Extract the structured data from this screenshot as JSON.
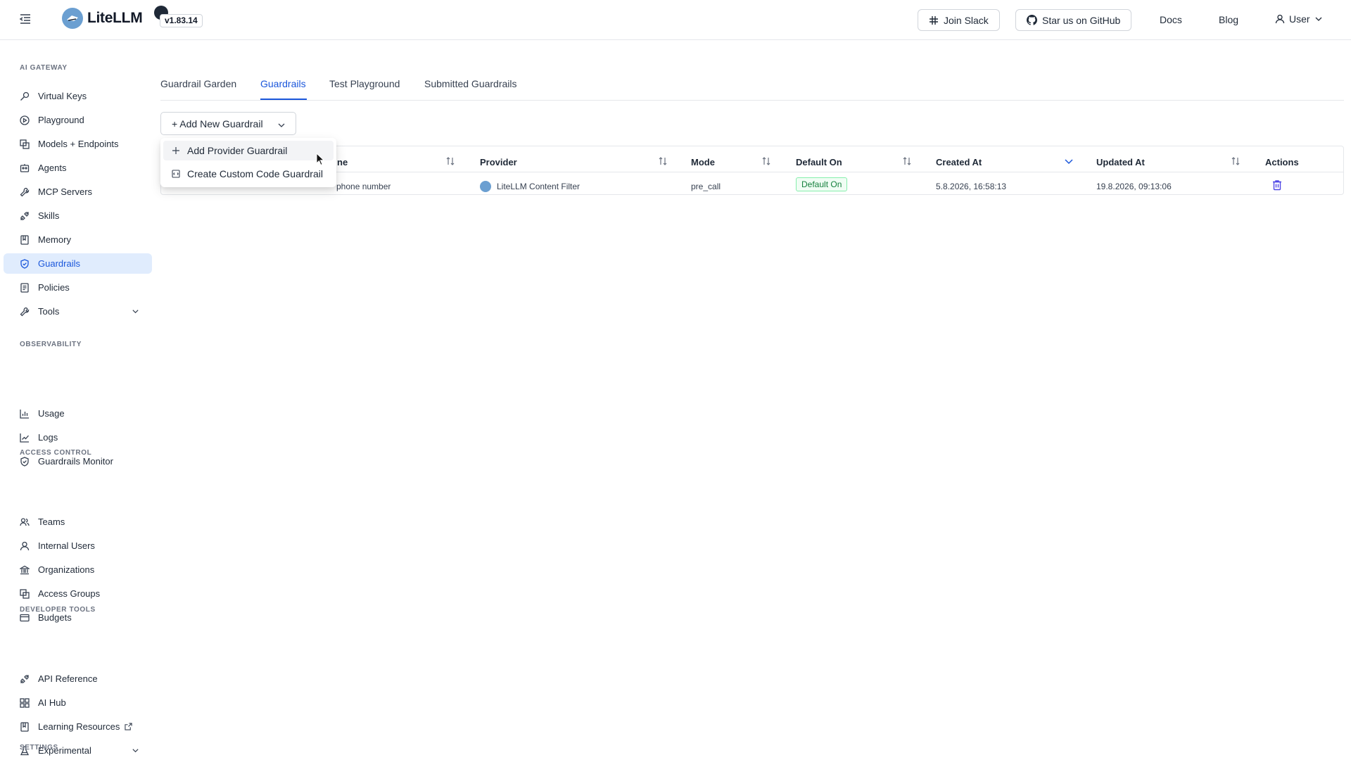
{
  "header": {
    "app_name": "LiteLLM",
    "version": "v1.83.14",
    "join_slack": "Join Slack",
    "star_github": "Star us on GitHub",
    "docs": "Docs",
    "blog": "Blog",
    "user": "User"
  },
  "sidebar": {
    "sections": {
      "ai_gateway": "AI GATEWAY",
      "observability": "OBSERVABILITY",
      "access_control": "ACCESS CONTROL",
      "developer_tools": "DEVELOPER TOOLS",
      "settings": "SETTINGS"
    },
    "items": [
      {
        "label": "Virtual Keys",
        "icon": "key-icon"
      },
      {
        "label": "Playground",
        "icon": "play-circle-icon"
      },
      {
        "label": "Models + Endpoints",
        "icon": "layers-icon"
      },
      {
        "label": "Agents",
        "icon": "robot-icon"
      },
      {
        "label": "MCP Servers",
        "icon": "tool-icon"
      },
      {
        "label": "Skills",
        "icon": "api-icon"
      },
      {
        "label": "Memory",
        "icon": "book-icon"
      },
      {
        "label": "Guardrails",
        "icon": "shield-icon"
      },
      {
        "label": "Policies",
        "icon": "audit-icon"
      },
      {
        "label": "Tools",
        "icon": "tool-icon"
      },
      {
        "label": "Usage",
        "icon": "bar-chart-icon"
      },
      {
        "label": "Logs",
        "icon": "line-chart-icon"
      },
      {
        "label": "Guardrails Monitor",
        "icon": "shield-icon"
      },
      {
        "label": "Teams",
        "icon": "team-icon"
      },
      {
        "label": "Internal Users",
        "icon": "user-icon"
      },
      {
        "label": "Organizations",
        "icon": "bank-icon"
      },
      {
        "label": "Access Groups",
        "icon": "layers-icon"
      },
      {
        "label": "Budgets",
        "icon": "credit-card-icon"
      },
      {
        "label": "API Reference",
        "icon": "api-icon"
      },
      {
        "label": "AI Hub",
        "icon": "grid-icon"
      },
      {
        "label": "Learning Resources",
        "icon": "book-icon"
      },
      {
        "label": "Experimental",
        "icon": "flask-icon"
      }
    ]
  },
  "tabs": [
    "Guardrail Garden",
    "Guardrails",
    "Test Playground",
    "Submitted Guardrails"
  ],
  "add_button": "+ Add New Guardrail",
  "dropdown": {
    "items": [
      "Add Provider Guardrail",
      "Create Custom Code Guardrail"
    ]
  },
  "table": {
    "headers": {
      "name": "ne",
      "provider": "Provider",
      "mode": "Mode",
      "default_on": "Default On",
      "created_at": "Created At",
      "updated_at": "Updated At",
      "actions": "Actions"
    },
    "row": {
      "name": "phone number",
      "provider": "LiteLLM Content Filter",
      "mode": "pre_call",
      "default_on": "Default On",
      "created_at": "5.8.2026, 16:58:13",
      "updated_at": "19.8.2026, 09:13:06"
    }
  },
  "colors": {
    "accent": "#1a56db",
    "active_nav_bg": "#e0ecfd",
    "badge_green": "#15803d",
    "trash": "#4f46e5"
  }
}
